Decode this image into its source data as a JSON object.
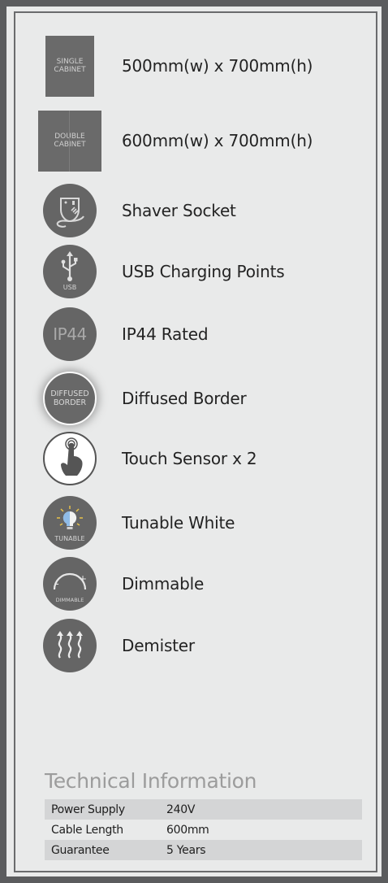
{
  "features": [
    {
      "label": "500mm(w) x 700mm(h)",
      "icon": "single-cabinet-icon",
      "icon_text": [
        "SINGLE",
        "CABINET"
      ]
    },
    {
      "label": "600mm(w) x 700mm(h)",
      "icon": "double-cabinet-icon",
      "icon_text": [
        "DOUBLE",
        "CABINET"
      ]
    },
    {
      "label": "Shaver Socket",
      "icon": "shaver-socket-icon"
    },
    {
      "label": "USB Charging Points",
      "icon": "usb-icon",
      "icon_text": [
        "USB"
      ]
    },
    {
      "label": "IP44 Rated",
      "icon": "ip44-icon",
      "icon_text": [
        "IP44"
      ]
    },
    {
      "label": "Diffused Border",
      "icon": "diffused-border-icon",
      "icon_text": [
        "DIFFUSED",
        "BORDER"
      ]
    },
    {
      "label": "Touch Sensor x 2",
      "icon": "touch-sensor-icon"
    },
    {
      "label": "Tunable White",
      "icon": "tunable-white-icon",
      "icon_text": [
        "TUNABLE"
      ]
    },
    {
      "label": "Dimmable",
      "icon": "dimmable-icon",
      "icon_text": [
        "DIMMABLE",
        "-",
        "+"
      ]
    },
    {
      "label": "Demister",
      "icon": "demister-icon"
    }
  ],
  "tech": {
    "title": "Technical Information",
    "rows": [
      {
        "key": "Power Supply",
        "value": "240V"
      },
      {
        "key": "Cable Length",
        "value": "600mm"
      },
      {
        "key": "Guarantee",
        "value": "5 Years"
      }
    ]
  },
  "colors": {
    "background": "#5b5c5e",
    "panel": "#e9eaea",
    "icon": "#656565",
    "row_shade": "#d4d5d6",
    "tunable_bulb": "#8fbbe6"
  }
}
